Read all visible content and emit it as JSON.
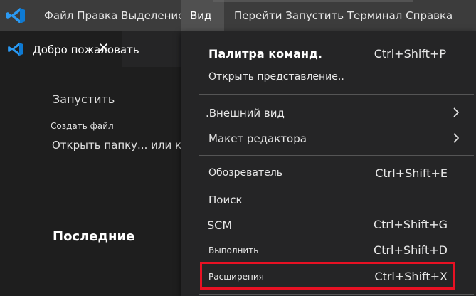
{
  "menubar": {
    "left_text": "Файл Правка Выделение",
    "view_label": "Вид",
    "right_text": "Перейти Запустить Терминал Справка",
    "logo_icon": "vscode-logo-icon"
  },
  "tab": {
    "title": "Добро пожаловать",
    "close_glyph": "✕"
  },
  "welcome": {
    "start": "Запустить",
    "new_file": "Создать файл",
    "open_folder": "Открыть папку... или клонировать",
    "recent": "Последние"
  },
  "view_menu": {
    "items": [
      {
        "label": "Палитра команд.",
        "shortcut": "Ctrl+Shift+P"
      },
      {
        "label": "Открыть представление..",
        "shortcut": ""
      },
      {
        "label": ".Внешний вид",
        "shortcut": ""
      },
      {
        "label": "Макет редактора",
        "shortcut": ""
      },
      {
        "label": "Обозреватель",
        "shortcut": "Ctrl+Shift+E"
      },
      {
        "label": "Поиск",
        "shortcut": ""
      },
      {
        "label": "SCM",
        "shortcut": "Ctrl+Shift+G"
      },
      {
        "label": "Выполнить",
        "shortcut": "Ctrl+Shift+D"
      },
      {
        "label": "Расширения",
        "shortcut": "Ctrl+Shift+X"
      }
    ]
  },
  "colors": {
    "highlight_border": "#e81123",
    "vscode_blue": "#0e7ad3"
  }
}
